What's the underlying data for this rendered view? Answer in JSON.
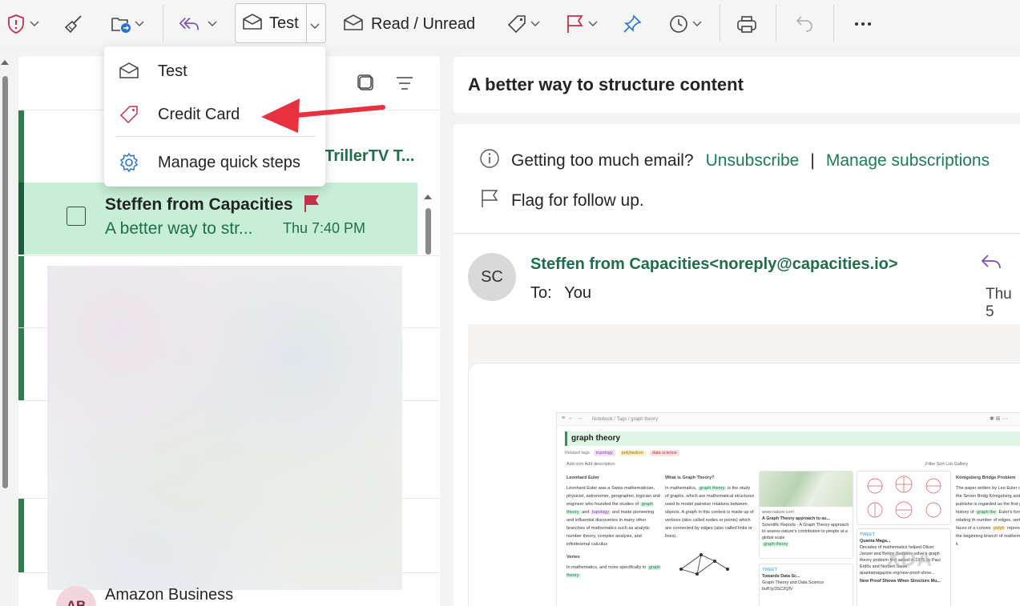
{
  "toolbar": {
    "quick_step_label": "Test",
    "read_unread_label": "Read / Unread"
  },
  "dropdown": {
    "items": [
      {
        "label": "Test",
        "icon": "envelope-icon"
      },
      {
        "label": "Credit Card",
        "icon": "tag-icon"
      },
      {
        "label": "Manage quick steps",
        "icon": "gear-icon"
      }
    ]
  },
  "list": {
    "partial_row_text": "; TrillerTV T...",
    "selected": {
      "sender": "Steffen from Capacities",
      "subject": "A better way to str...",
      "time": "Thu 7:40 PM"
    },
    "next_row": {
      "avatar": "AB",
      "sender": "Amazon Business"
    }
  },
  "reading": {
    "subject": "A better way to structure content",
    "info_text": "Getting too much email?",
    "unsubscribe": "Unsubscribe",
    "separator": "|",
    "manage_subscriptions": "Manage subscriptions",
    "flag_text": "Flag for follow up.",
    "avatar": "SC",
    "from": "Steffen from Capacities<noreply@capacities.io>",
    "to_label": "To:",
    "to_value": "You",
    "date": "Thu 5"
  },
  "embedded": {
    "crumb": "Notebook  /  Tags  /  graph theory",
    "title": "graph theory",
    "related_tags_label": "Related tags",
    "tags": [
      "topology",
      "polyhedron",
      "data science"
    ],
    "actions": "Add icon   Add description",
    "toolbar_right": "Filter   Sort   List   Gallery",
    "col1_heading": "Leonhard Euler",
    "col1_text_pre": "Leonhard Euler was a Swiss mathematician, physicist, astronomer, geographer, logician and engineer who founded the studies of",
    "col1_hl1": "graph theory",
    "col1_text_mid": "and",
    "col1_hl2": "topology",
    "col1_text_post": "and made pioneering and influential discoveries in many other branches of mathematics such as analytic number theory, complex analysis, and infinitesimal calculus",
    "col1_heading2": "Vertex",
    "col1_text2": "In mathematics, and more specifically in",
    "col1_hl3": "graph theory",
    "col2_heading": "What is Graph Theory?",
    "col2_text_pre": "In mathematics,",
    "col2_hl": "graph theory",
    "col2_text_post": "is the study of graphs, which are mathematical structures used to model pairwise relations between objects. A graph in this context is made up of vertices (also called nodes or points) which are connected by edges (also called links or lines).",
    "card1_site": "www.nature.com",
    "card1_title": "A Graph Theory approach to as...",
    "card1_text": "Scientific Reports - A Graph Theory approach to assess nature's contribution to people at a global scale",
    "card1_tag": "graph theory",
    "card2_label": "TWEET",
    "card2_title": "Towards Data Sc...",
    "card2_text": "Graph Theory and Data Science buff.ly/3SC2QfV",
    "card3_label": "TWEET",
    "card3_title": "Quanta Maga...",
    "card3_text": "Decades of mathematics helped Oliver Janzer and Benny Sudakov solve a graph theory problem first asked in 1975 by Paul Erdős and Norbert Sauer. quantamagazine.org/new-proof-show...",
    "card3_footer": "New Proof Shows When Structure Mu...",
    "col5_heading": "Königsberg Bridge Problem",
    "col5_text": "The paper written by Leo Euler on the Seven Bridg Königsberg and publishe is regarded as the first p the history of",
    "col5_hl": "graph the",
    "col5_text2": "Euler's formula relating th number of edges, vertic faces of a convex",
    "col5_hl2": "polyh",
    "col5_text3": "represents the beginning branch of mathematics k",
    "watermark": "XDA"
  },
  "colors": {
    "accent_green": "#1f6e4a",
    "selected_row": "#c6efd6",
    "flag_red": "#c4314b",
    "toolbar_purple": "#7b4fb0",
    "toolbar_blue": "#2b74c9"
  }
}
